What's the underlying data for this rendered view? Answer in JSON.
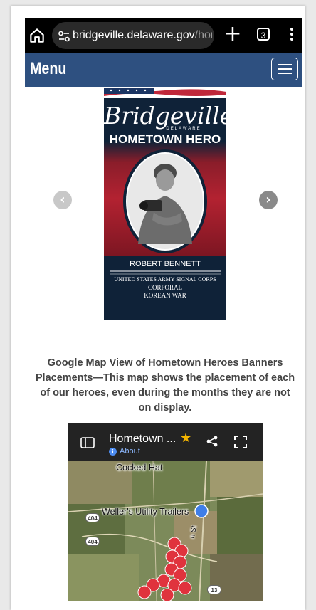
{
  "browser": {
    "url_host": "bridgeville.delaware.gov",
    "url_rest": "/hom",
    "tab_count": "3",
    "icons": [
      "home-icon",
      "site-settings-icon",
      "new-tab-icon",
      "tabs-icon",
      "more-menu-icon"
    ]
  },
  "site": {
    "menu_label": "Menu",
    "accent_color": "#2e5080"
  },
  "banner": {
    "town": "Bridgeville",
    "state": "DELAWARE",
    "title": "HOMETOWN HERO",
    "name": "ROBERT BENNETT",
    "line1": "UNITED STATES ARMY SIGNAL CORPS",
    "line2": "CORPORAL",
    "line3": "KOREAN WAR",
    "colors": {
      "navy": "#0f2238",
      "red": "#b32231"
    }
  },
  "carousel": {
    "prev_icon": "chevron-left-icon",
    "next_icon": "chevron-right-icon"
  },
  "caption": "Google Map View of Hometown Heroes Banners Placements—This map shows the placement of each of our heroes, even during the months they are not on display.",
  "map": {
    "title": "Hometown ...",
    "about": "About",
    "labels": {
      "cocked_hat": "Cocked Hat",
      "wellers": "Weller's Utility Trailers",
      "street": "n St"
    },
    "routes": [
      "404",
      "404",
      "13"
    ]
  }
}
